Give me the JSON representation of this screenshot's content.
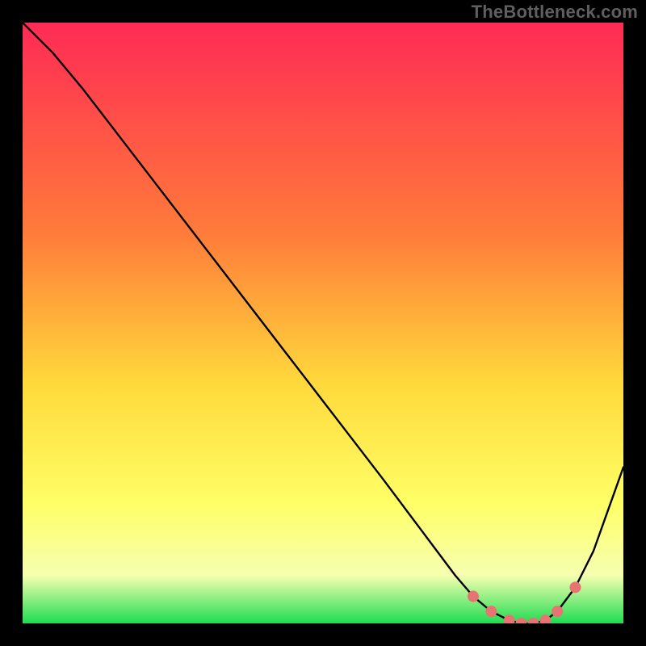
{
  "watermark": "TheBottleneck.com",
  "colors": {
    "frame": "#000000",
    "curve": "#000000",
    "marker": "#e87373",
    "grad_top": "#ff2a55",
    "grad_mid1": "#ff7b3a",
    "grad_mid2": "#ffd93b",
    "grad_mid3": "#ffff66",
    "grad_mid4": "#f6ffb0",
    "grad_bottom": "#1fdc52"
  },
  "chart_data": {
    "type": "line",
    "title": "",
    "xlabel": "",
    "ylabel": "",
    "x": [
      0,
      5,
      10,
      15,
      20,
      25,
      30,
      35,
      40,
      45,
      50,
      55,
      60,
      63,
      66,
      69,
      72,
      75,
      78,
      81,
      83,
      85,
      87,
      89,
      92,
      95,
      100
    ],
    "values": [
      100,
      95,
      89,
      82.5,
      76,
      69.5,
      63,
      56.5,
      50,
      43.5,
      37,
      30.5,
      24,
      20,
      16,
      12,
      8,
      4.5,
      2,
      0.5,
      0,
      0,
      0.5,
      2,
      6,
      12,
      26
    ],
    "marker_indices": [
      17,
      18,
      19,
      20,
      21,
      22,
      23,
      24
    ],
    "xlim": [
      0,
      100
    ],
    "ylim": [
      0,
      100
    ]
  }
}
